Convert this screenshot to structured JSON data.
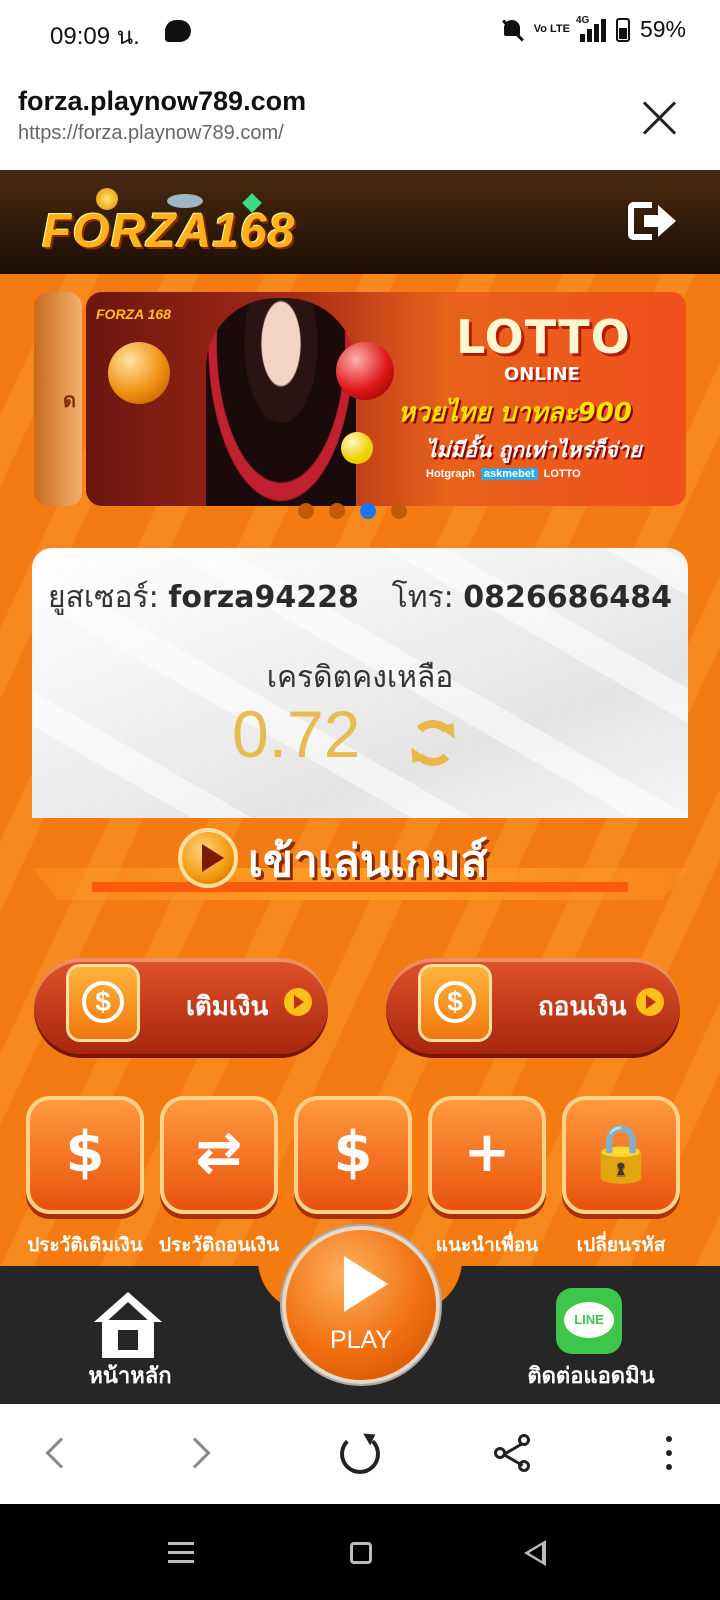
{
  "status_bar": {
    "time": "09:09 น.",
    "network": "4G",
    "volte": "Vo LTE",
    "battery": "59%"
  },
  "url_bar": {
    "host": "forza.playnow789.com",
    "url": "https://forza.playnow789.com/",
    "close_icon": "close-icon"
  },
  "header": {
    "logo_text": "FORZA168",
    "logout_icon": "logout-icon"
  },
  "banner": {
    "prev_fragment": "ด",
    "mini_logo": "FORZA 168",
    "title": "LOTTO",
    "subtitle": "ONLINE",
    "line1": "หวยไทย บาทละ900",
    "line2": "ไม่มีอั้น ถูกเท่าไหร่ก็จ่าย",
    "sponsors": [
      "Hotgraph",
      "askmebet",
      "LOTTO"
    ],
    "slide_count": 4,
    "active_slide": 3
  },
  "account": {
    "user_label": "ยูสเซอร์:",
    "user_value": "forza94228",
    "phone_label": "โทร:",
    "phone_value": "0826686484",
    "credit_label": "เครดิตคงเหลือ",
    "credit_value": "0.72"
  },
  "enter_game": {
    "label": "เข้าเล่นเกมส์"
  },
  "wallet": {
    "deposit_label": "เติมเงิน",
    "withdraw_label": "ถอนเงิน"
  },
  "menu_tiles": [
    {
      "label": "ประวัติเติมเงิน",
      "icon": "money-bag-clock-icon"
    },
    {
      "label": "ประวัติถอนเงิน",
      "icon": "withdraw-history-icon"
    },
    {
      "label": "",
      "icon": "hand-coin-icon"
    },
    {
      "label": "แนะนำเพื่อน",
      "icon": "add-friend-icon"
    },
    {
      "label": "เปลี่ยนรหัส",
      "icon": "lock-password-icon"
    }
  ],
  "bottom_nav": {
    "home_label": "หน้าหลัก",
    "play_label": "PLAY",
    "contact_label": "ติดต่อแอดมิน",
    "line_logo": "LINE"
  },
  "colors": {
    "brand_orange": "#f47a12",
    "header_dark": "#1c0e04",
    "credit_gold": "#e8bb52",
    "slider_active": "#1877f2"
  }
}
